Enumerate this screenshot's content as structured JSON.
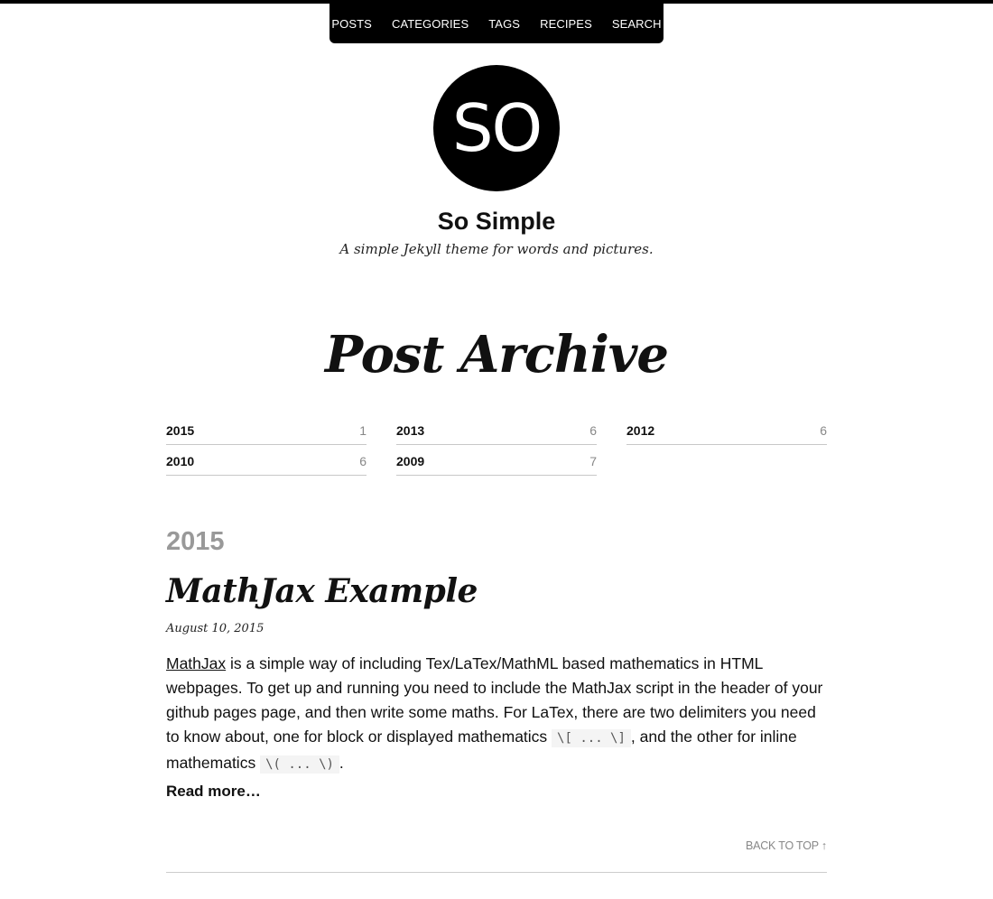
{
  "nav": {
    "items": [
      "POSTS",
      "CATEGORIES",
      "TAGS",
      "RECIPES",
      "SEARCH"
    ]
  },
  "site": {
    "logo_text": "SO",
    "title": "So Simple",
    "description": "A simple Jekyll theme for words and pictures."
  },
  "page": {
    "title": "Post Archive"
  },
  "archive": {
    "years": [
      {
        "year": "2015",
        "count": "1"
      },
      {
        "year": "2013",
        "count": "6"
      },
      {
        "year": "2012",
        "count": "6"
      },
      {
        "year": "2010",
        "count": "6"
      },
      {
        "year": "2009",
        "count": "7"
      }
    ]
  },
  "section": {
    "year": "2015",
    "post": {
      "title": "MathJax Example",
      "date": "August 10, 2015",
      "link_text": "MathJax",
      "text_1": " is a simple way of including Tex/LaTex/MathML based mathematics in HTML webpages. To get up and running you need to include the MathJax script in the header of your github pages page, and then write some maths. For LaTex, there are two delimiters you need to know about, one for block or displayed mathematics ",
      "code_1": "\\[ ... \\]",
      "text_2": ", and the other for inline mathematics ",
      "code_2": "\\( ... \\)",
      "text_3": ".",
      "read_more": "Read more…"
    }
  },
  "footer": {
    "back_to_top": "BACK TO TOP ↑"
  }
}
